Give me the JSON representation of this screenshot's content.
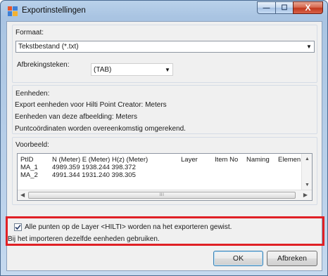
{
  "window": {
    "title": "Exportinstellingen",
    "controls": {
      "minimize": "—",
      "maximize": "☐",
      "close": "X"
    }
  },
  "format": {
    "label": "Formaat:",
    "selected": "Tekstbestand (*.txt)",
    "delimiter_label": "Afbrekingsteken:",
    "delimiter_value": "(TAB)"
  },
  "units": {
    "label": "Eenheden:",
    "lines": [
      "Export eenheden voor Hilti Point Creator: Meters",
      "Eenheden van deze afbeelding: Meters",
      "Puntcoördinaten worden overeenkomstig omgerekend."
    ]
  },
  "preview": {
    "label": "Voorbeeld:",
    "columns": [
      "PtID",
      "N (Meter) E (Meter) H(z) (Meter)",
      "Layer",
      "Item No",
      "Naming",
      "Elemen"
    ],
    "rows": [
      [
        "MA_1",
        "4989.359 1938.244 398.372"
      ],
      [
        "MA_2",
        "4991.344 1931.240 398.305"
      ]
    ],
    "scroll_up": "▲",
    "scroll_down": "▼",
    "scroll_left": "◀",
    "scroll_right": "▶",
    "thumb_grip": "III"
  },
  "options": {
    "checkbox_label": "Alle punten op de Layer <HILTI> worden na het exporteren gewist.",
    "checked": true,
    "note": "Bij het importeren dezelfde eenheden gebruiken."
  },
  "buttons": {
    "ok": "OK",
    "cancel": "Afbreken"
  },
  "colors": {
    "highlight": "#e02025",
    "title_gradient": "#b9d1ea",
    "close_button": "#c1391d"
  }
}
